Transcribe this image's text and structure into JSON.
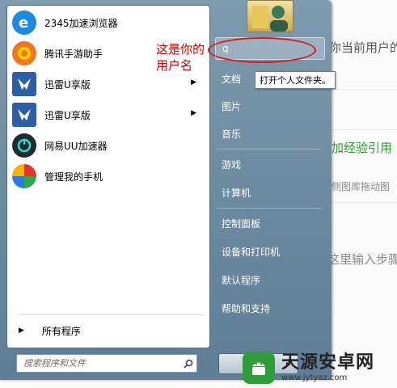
{
  "background_page": {
    "text_current_user": "你当前用户的",
    "text_add_reference": "加经验引用",
    "text_drag_image": "侧图库拖动图",
    "text_input_steps": "这里输入步骤"
  },
  "start_menu": {
    "programs": [
      {
        "label": "2345加速浏览器",
        "icon": "browser-e-icon",
        "has_submenu": false
      },
      {
        "label": "腾讯手游助手",
        "icon": "tencent-game-icon",
        "has_submenu": false
      },
      {
        "label": "迅雷U享版",
        "icon": "xunlei-bird-icon",
        "has_submenu": true
      },
      {
        "label": "迅雷U享版",
        "icon": "xunlei-bird-icon",
        "has_submenu": true
      },
      {
        "label": "网易UU加速器",
        "icon": "uu-accelerator-icon",
        "has_submenu": false
      },
      {
        "label": "管理我的手机",
        "icon": "phone-manager-icon",
        "has_submenu": false
      }
    ],
    "all_programs_label": "所有程序",
    "search_placeholder": "搜索程序和文件",
    "right_items": {
      "user_name": "q",
      "documents": "文档",
      "pictures": "图片",
      "music": "音乐",
      "games": "游戏",
      "computer": "计算机",
      "control_panel": "控制面板",
      "devices_printers": "设备和打印机",
      "default_programs": "默认程序",
      "help_support": "帮助和支持"
    },
    "tooltip": "打开个人文件夹。"
  },
  "annotation": {
    "text": "这是你的\n用户名",
    "color": "#d40000"
  },
  "watermark": {
    "title": "天源安卓网",
    "url": "www.jytyaz.com"
  },
  "colors": {
    "menu_glass": "#6c8aa0",
    "accent_red": "#e01818",
    "green_text": "#2e9a2e"
  }
}
